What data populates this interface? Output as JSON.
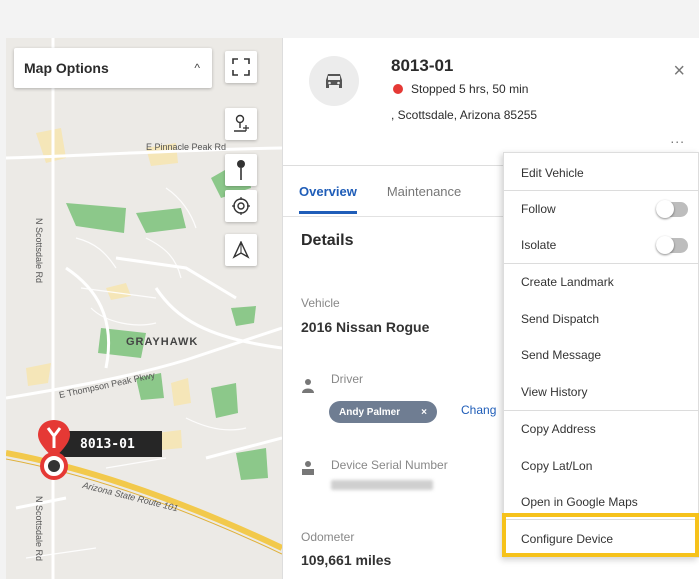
{
  "map": {
    "options_label": "Map Options",
    "options_caret": "^",
    "labels": {
      "pinnacle_peak": "E Pinnacle Peak Rd",
      "scottsdale_rd_upper": "N Scottsdale Rd",
      "scottsdale_rd_lower": "N Scottsdale Rd",
      "grayhawk": "GRAYHAWK",
      "thompson_peak": "E Thompson Peak Pkwy",
      "state_route": "Arizona State Route 101"
    },
    "vehicle_marker_label": "8013-01"
  },
  "panel": {
    "vehicle_id": "8013-01",
    "status_text": "Stopped 5 hrs, 50 min",
    "address": ", Scottsdale, Arizona 85255",
    "close_glyph": "×",
    "more_glyph": "...",
    "tabs": [
      {
        "label": "Overview"
      },
      {
        "label": "Maintenance"
      }
    ],
    "details_title": "Details",
    "vehicle_label": "Vehicle",
    "vehicle_value": "2016 Nissan Rogue",
    "driver_label": "Driver",
    "driver_chip": "Andy Palmer",
    "driver_chip_remove": "×",
    "change_link": "Chang",
    "serial_label": "Device Serial Number",
    "odometer_label": "Odometer",
    "odometer_value": "109,661 miles"
  },
  "menu": {
    "items": [
      {
        "label": "Edit Vehicle"
      },
      {
        "label": "Follow"
      },
      {
        "label": "Isolate"
      },
      {
        "label": "Create Landmark"
      },
      {
        "label": "Send Dispatch"
      },
      {
        "label": "Send Message"
      },
      {
        "label": "View History"
      },
      {
        "label": "Copy Address"
      },
      {
        "label": "Copy Lat/Lon"
      },
      {
        "label": "Open in Google Maps"
      },
      {
        "label": "Configure Device"
      }
    ]
  },
  "colors": {
    "accent": "#1f5db8",
    "status_stopped": "#e53935",
    "highlight": "#f6c21b",
    "marker": "#e53935"
  }
}
